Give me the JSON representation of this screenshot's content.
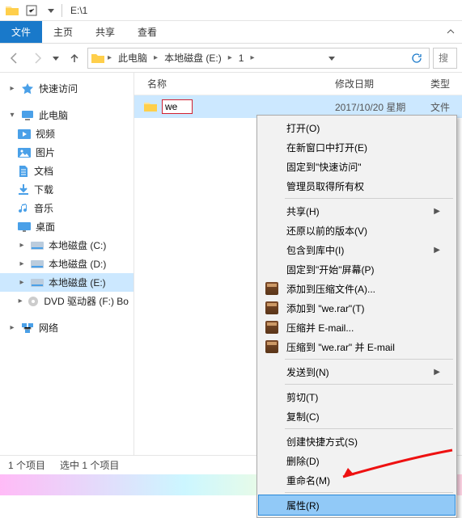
{
  "titlebar": {
    "path": "E:\\1"
  },
  "ribbon": {
    "file": "文件",
    "tabs": [
      "主页",
      "共享",
      "查看"
    ]
  },
  "navbar": {
    "crumbs": [
      "此电脑",
      "本地磁盘 (E:)",
      "1"
    ],
    "search_placeholder": "搜"
  },
  "columns": {
    "name": "名称",
    "date": "修改日期",
    "type": "类型"
  },
  "files": [
    {
      "name": "we",
      "date": "2017/10/20 星期",
      "type": "文件"
    }
  ],
  "nav_pane": {
    "quick_access": "快速访问",
    "this_pc": "此电脑",
    "children": [
      "视频",
      "图片",
      "文档",
      "下载",
      "音乐",
      "桌面",
      "本地磁盘 (C:)",
      "本地磁盘 (D:)",
      "本地磁盘 (E:)",
      "DVD 驱动器 (F:) Bo"
    ],
    "network": "网络"
  },
  "context_menu": {
    "items": [
      {
        "label": "打开(O)"
      },
      {
        "label": "在新窗口中打开(E)"
      },
      {
        "label": "固定到\"快速访问\""
      },
      {
        "label": "管理员取得所有权"
      },
      {
        "sep": true
      },
      {
        "label": "共享(H)",
        "sub": true
      },
      {
        "label": "还原以前的版本(V)"
      },
      {
        "label": "包含到库中(I)",
        "sub": true
      },
      {
        "label": "固定到\"开始\"屏幕(P)"
      },
      {
        "label": "添加到压缩文件(A)...",
        "icon": "rar"
      },
      {
        "label": "添加到 \"we.rar\"(T)",
        "icon": "rar"
      },
      {
        "label": "压缩并 E-mail...",
        "icon": "rar"
      },
      {
        "label": "压缩到 \"we.rar\" 并 E-mail",
        "icon": "rar"
      },
      {
        "sep": true
      },
      {
        "label": "发送到(N)",
        "sub": true
      },
      {
        "sep": true
      },
      {
        "label": "剪切(T)"
      },
      {
        "label": "复制(C)"
      },
      {
        "sep": true
      },
      {
        "label": "创建快捷方式(S)"
      },
      {
        "label": "删除(D)"
      },
      {
        "label": "重命名(M)"
      },
      {
        "sep": true
      },
      {
        "label": "属性(R)",
        "highlighted": true
      }
    ]
  },
  "statusbar": {
    "count": "1 个项目",
    "selected": "选中 1 个项目"
  },
  "colors": {
    "accent": "#1979ca",
    "selection": "#cce8ff"
  }
}
